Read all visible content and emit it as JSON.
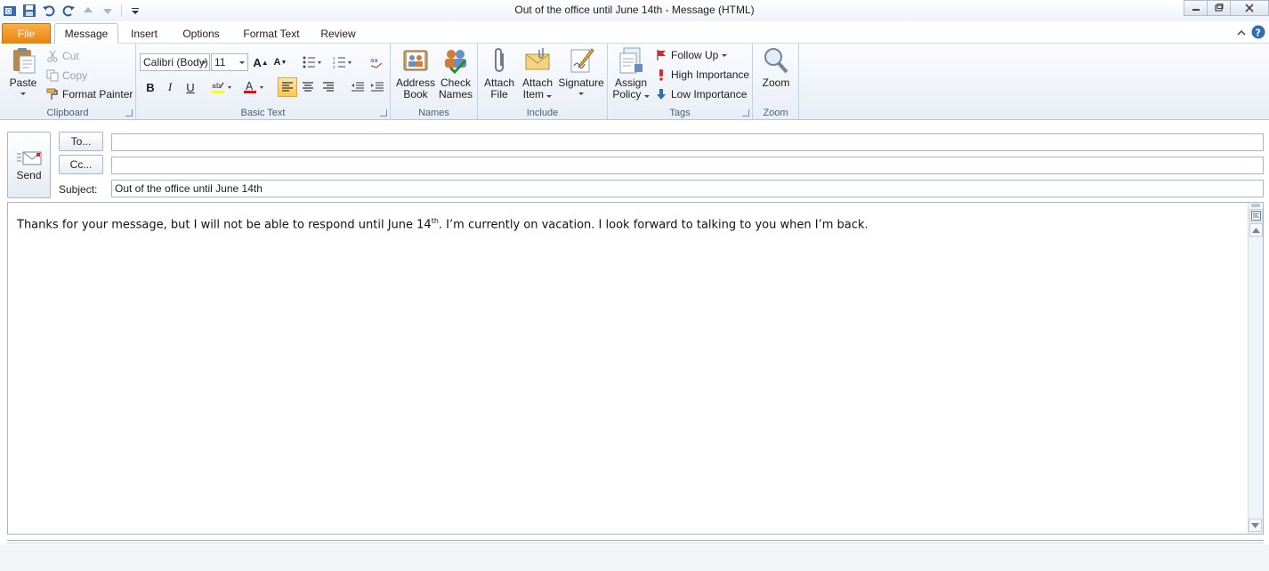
{
  "window": {
    "title": "Out of the office until June 14th  -  Message (HTML)"
  },
  "tabs": [
    {
      "label": "File"
    },
    {
      "label": "Message"
    },
    {
      "label": "Insert"
    },
    {
      "label": "Options"
    },
    {
      "label": "Format Text"
    },
    {
      "label": "Review"
    }
  ],
  "ribbon": {
    "clipboard": {
      "label": "Clipboard",
      "paste": "Paste",
      "cut": "Cut",
      "copy": "Copy",
      "format_painter": "Format Painter"
    },
    "basic_text": {
      "label": "Basic Text",
      "font": "Calibri (Body)",
      "size": "11",
      "bold": "B",
      "italic": "I",
      "underline": "U"
    },
    "names": {
      "label": "Names",
      "address_book_1": "Address",
      "address_book_2": "Book",
      "check_names_1": "Check",
      "check_names_2": "Names"
    },
    "include": {
      "label": "Include",
      "attach_file_1": "Attach",
      "attach_file_2": "File",
      "attach_item_1": "Attach",
      "attach_item_2": "Item",
      "signature": "Signature"
    },
    "tags": {
      "label": "Tags",
      "assign_policy_1": "Assign",
      "assign_policy_2": "Policy",
      "follow_up": "Follow Up",
      "high_importance": "High Importance",
      "low_importance": "Low Importance"
    },
    "zoom": {
      "label": "Zoom",
      "zoom": "Zoom"
    }
  },
  "compose": {
    "send": "Send",
    "to_button": "To...",
    "cc_button": "Cc...",
    "subject_label": "Subject:",
    "to_value": "",
    "cc_value": "",
    "subject_value": "Out of the office until June 14th"
  },
  "message": {
    "body_part1": "Thanks for your message, but I will not be able to respond until June 14",
    "body_sup": "th",
    "body_part2": ". I’m currently on vacation. I look forward to talking to you when I’m back."
  },
  "colors": {
    "file_tab": "#e8820c",
    "highlight": "#ffff00",
    "font_color": "#e01010"
  }
}
